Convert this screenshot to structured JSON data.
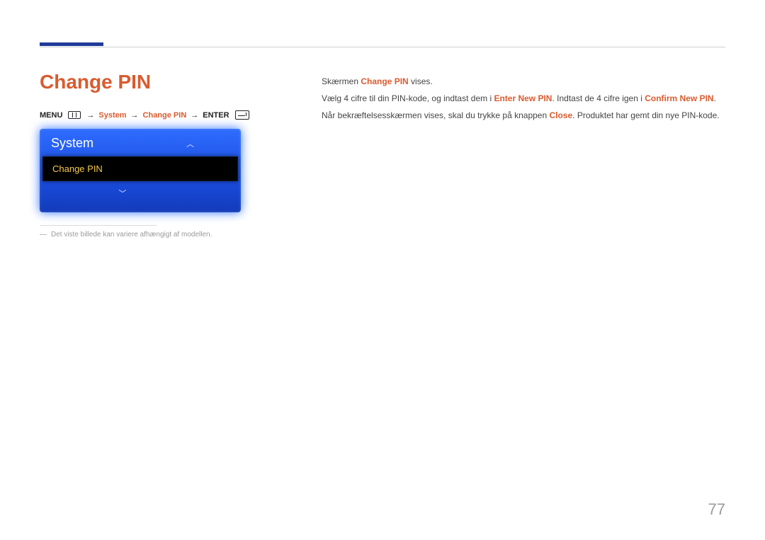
{
  "heading": "Change PIN",
  "breadcrumb": {
    "menu_label": "MENU",
    "system": "System",
    "change_pin": "Change PIN",
    "enter_label": "ENTER"
  },
  "osd": {
    "header": "System",
    "selected_item": "Change PIN"
  },
  "note": "Det viste billede kan variere afhængigt af modellen.",
  "body": {
    "line1_pre": "Skærmen ",
    "line1_hl": "Change PIN",
    "line1_post": " vises.",
    "line2_pre": "Vælg 4 cifre til din PIN-kode, og indtast dem i ",
    "line2_hl1": "Enter New PIN",
    "line2_mid": ". Indtast de 4 cifre igen i ",
    "line2_hl2": "Confirm New PIN",
    "line2_post": ".",
    "line3_pre": "Når bekræftelsesskærmen vises, skal du trykke på knappen ",
    "line3_hl": "Close",
    "line3_post": ". Produktet har gemt din nye PIN-kode."
  },
  "page_number": "77"
}
